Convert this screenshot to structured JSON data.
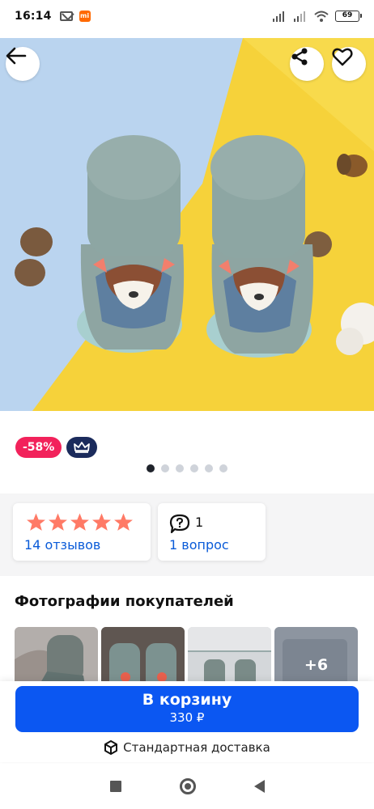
{
  "status_bar": {
    "time": "16:14",
    "battery": "69",
    "icons": [
      "mail-icon",
      "mi-app-icon",
      "signal-icon",
      "signal-icon",
      "wifi-icon",
      "battery-icon"
    ]
  },
  "header": {
    "back_icon": "arrow-left-icon",
    "share_icon": "share-icon",
    "favorite_icon": "heart-icon"
  },
  "product": {
    "discount_badge": "-58%",
    "premium_icon": "crown-icon",
    "image_count": 6,
    "active_image": 1
  },
  "reviews": {
    "rating_stars": 5,
    "reviews_label": "14 отзывов",
    "questions_count": "1",
    "questions_label": "1 вопрос"
  },
  "customer_photos": {
    "title": "Фотографии покупателей",
    "more_label": "+6"
  },
  "cart": {
    "button_label": "В корзину",
    "price": "330 ₽",
    "delivery_label": "Стандартная доставка"
  },
  "colors": {
    "accent": "#0b57f2",
    "discount": "#f2225b",
    "premium": "#1b2b5c",
    "star": "#ff7a66",
    "link": "#0a5bd8"
  }
}
